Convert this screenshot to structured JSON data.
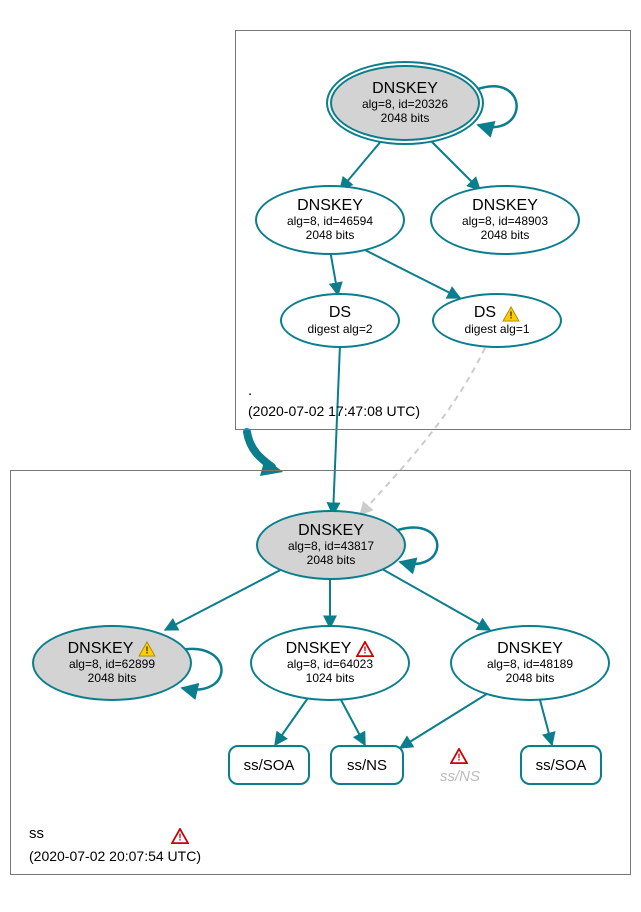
{
  "zones": {
    "root": {
      "label": ".",
      "timestamp": "(2020-07-02 17:47:08 UTC)"
    },
    "ss": {
      "label": "ss",
      "timestamp": "(2020-07-02 20:07:54 UTC)"
    }
  },
  "nodes": {
    "root_ksk": {
      "title": "DNSKEY",
      "line1": "alg=8, id=20326",
      "line2": "2048 bits"
    },
    "root_zsk1": {
      "title": "DNSKEY",
      "line1": "alg=8, id=46594",
      "line2": "2048 bits"
    },
    "root_zsk2": {
      "title": "DNSKEY",
      "line1": "alg=8, id=48903",
      "line2": "2048 bits"
    },
    "ds1": {
      "title": "DS",
      "line1": "digest alg=2"
    },
    "ds2": {
      "title": "DS",
      "line1": "digest alg=1"
    },
    "ss_ksk": {
      "title": "DNSKEY",
      "line1": "alg=8, id=43817",
      "line2": "2048 bits"
    },
    "ss_key1": {
      "title": "DNSKEY",
      "line1": "alg=8, id=62899",
      "line2": "2048 bits"
    },
    "ss_key2": {
      "title": "DNSKEY",
      "line1": "alg=8, id=64023",
      "line2": "1024 bits"
    },
    "ss_key3": {
      "title": "DNSKEY",
      "line1": "alg=8, id=48189",
      "line2": "2048 bits"
    }
  },
  "records": {
    "soa1": "ss/SOA",
    "ns1": "ss/NS",
    "ns_ghost": "ss/NS",
    "soa2": "ss/SOA"
  }
}
